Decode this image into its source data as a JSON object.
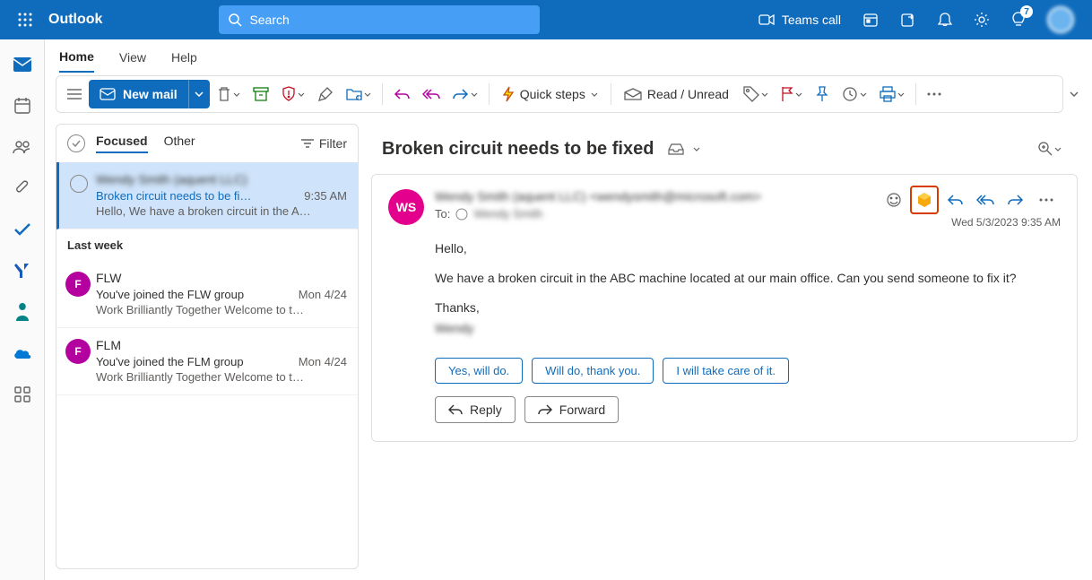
{
  "header": {
    "app_title": "Outlook",
    "search_placeholder": "Search",
    "teams_call": "Teams call",
    "tips_badge": "7"
  },
  "tabs": {
    "home": "Home",
    "view": "View",
    "help": "Help"
  },
  "ribbon": {
    "new_mail": "New mail",
    "quick_steps": "Quick steps",
    "read_unread": "Read / Unread"
  },
  "list": {
    "focused": "Focused",
    "other": "Other",
    "filter": "Filter",
    "group_lastweek": "Last week",
    "items": [
      {
        "from": "Wendy Smith (aquent LLC)",
        "subject": "Broken circuit needs to be fi…",
        "time": "9:35 AM",
        "preview": "Hello, We have a broken circuit in the A…"
      },
      {
        "from": "FLW",
        "subject": "You've joined the FLW group",
        "time": "Mon 4/24",
        "preview": "Work Brilliantly Together Welcome to t…",
        "initial": "F",
        "color": "#b4009e"
      },
      {
        "from": "FLM",
        "subject": "You've joined the FLM group",
        "time": "Mon 4/24",
        "preview": "Work Brilliantly Together Welcome to t…",
        "initial": "F",
        "color": "#b4009e"
      }
    ]
  },
  "reading": {
    "subject": "Broken circuit needs to be fixed",
    "sender_initials": "WS",
    "sender_line": "Wendy Smith (aquent LLC) <wendysmith@microsoft.com>",
    "to_label": "To:",
    "to_name": "Wendy Smith",
    "datetime": "Wed 5/3/2023 9:35 AM",
    "body_greeting": "Hello,",
    "body_main": "We have a broken circuit in the ABC machine located at   our main office. Can you send someone to fix it?",
    "body_thanks": "Thanks,",
    "body_sign": "Wendy",
    "suggestions": [
      "Yes, will do.",
      "Will do, thank you.",
      "I will take care of it."
    ],
    "reply": "Reply",
    "forward": "Forward"
  }
}
